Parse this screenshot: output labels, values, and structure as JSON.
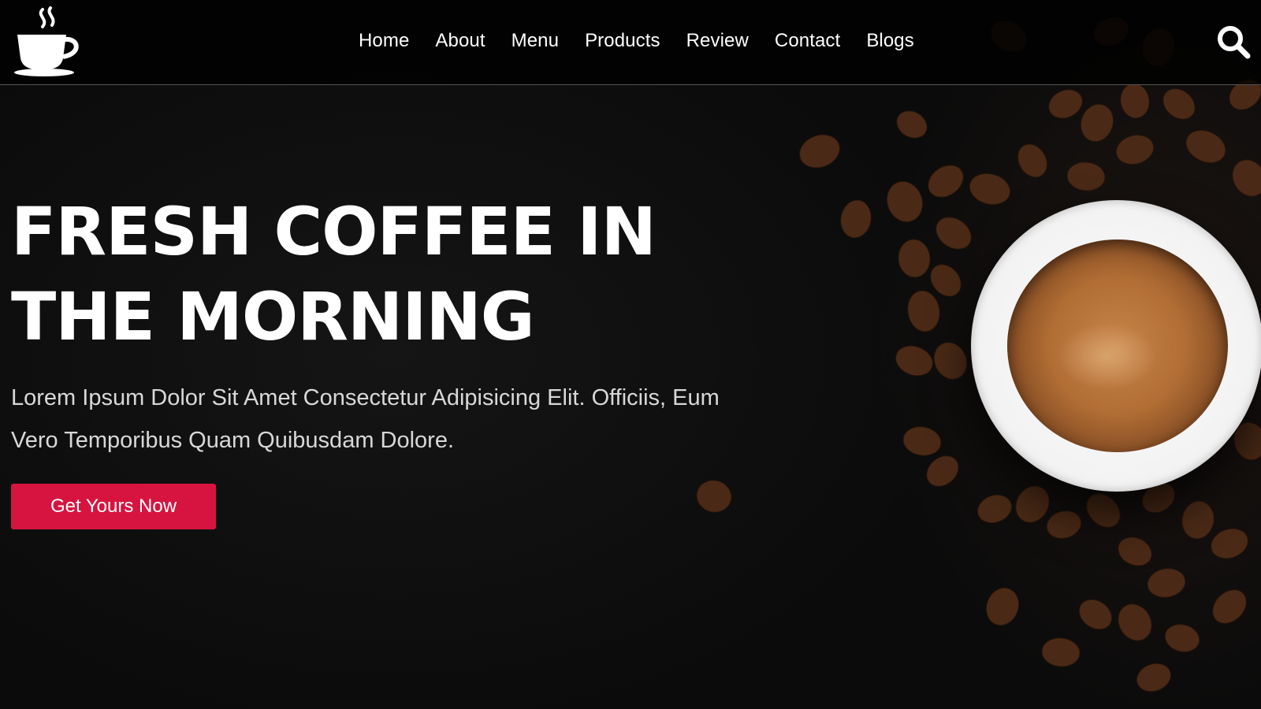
{
  "nav": {
    "items": [
      {
        "label": "Home"
      },
      {
        "label": "About"
      },
      {
        "label": "Menu"
      },
      {
        "label": "Products"
      },
      {
        "label": "Review"
      },
      {
        "label": "Contact"
      },
      {
        "label": "Blogs"
      }
    ]
  },
  "hero": {
    "title": "FRESH COFFEE IN THE MORNING",
    "subtitle": "Lorem Ipsum Dolor Sit Amet Consectetur Adipisicing Elit. Officiis, Eum Vero Temporibus Quam Quibusdam Dolore.",
    "cta_label": "Get Yours Now"
  },
  "icons": {
    "logo": "coffee-cup-icon",
    "search": "search-icon"
  },
  "colors": {
    "accent": "#d71440",
    "background": "#0c0c0c",
    "text": "#ffffff"
  }
}
